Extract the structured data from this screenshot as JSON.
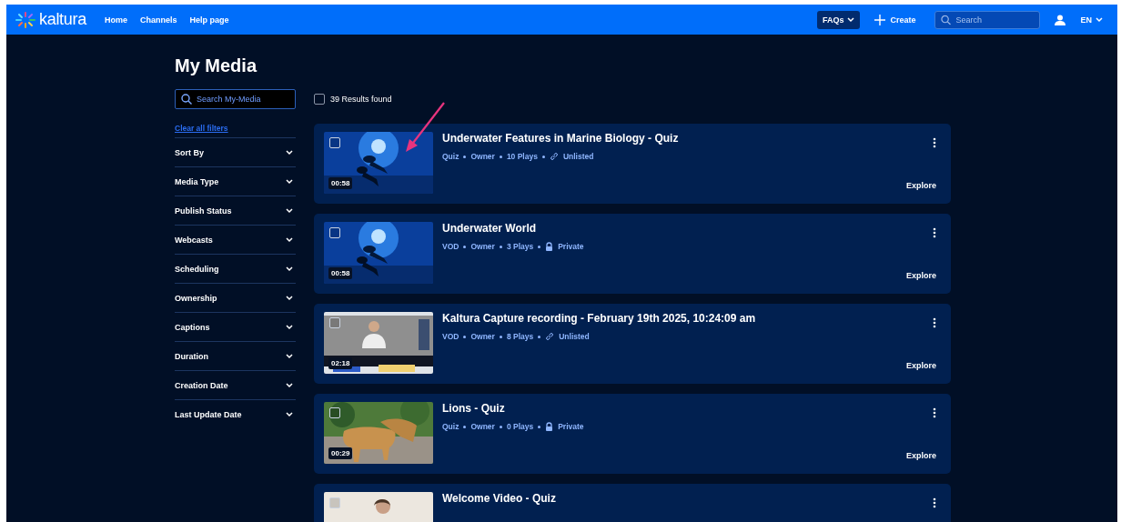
{
  "header": {
    "logo": "kaltura",
    "nav": [
      "Home",
      "Channels",
      "Help page"
    ],
    "faqs": "FAQs",
    "create": "Create",
    "search": {
      "placeholder": "Search"
    },
    "language": "EN"
  },
  "page_title": "My Media",
  "search": {
    "placeholder": "Search My-Media"
  },
  "results": {
    "label": "39 Results found",
    "checked": false
  },
  "clear_filters": "Clear all filters",
  "filters": [
    {
      "label": "Sort By",
      "expanded": false
    },
    {
      "label": "Media Type",
      "expanded": false
    },
    {
      "label": "Publish Status",
      "expanded": false
    },
    {
      "label": "Webcasts",
      "expanded": false
    },
    {
      "label": "Scheduling",
      "expanded": false
    },
    {
      "label": "Ownership",
      "expanded": false
    },
    {
      "label": "Captions",
      "expanded": false
    },
    {
      "label": "Duration",
      "expanded": false
    },
    {
      "label": "Creation Date",
      "expanded": false
    },
    {
      "label": "Last Update Date",
      "expanded": false
    }
  ],
  "media": [
    {
      "title": "Underwater Features in Marine Biology - Quiz",
      "duration": "00:58",
      "checked": false,
      "meta": [
        "Quiz",
        "Owner",
        "10 Plays"
      ],
      "privacy": {
        "kind": "link",
        "label": "Unlisted"
      },
      "action": "Explore"
    },
    {
      "title": "Underwater World",
      "duration": "00:58",
      "checked": false,
      "meta": [
        "VOD",
        "Owner",
        "3 Plays"
      ],
      "privacy": {
        "kind": "lock",
        "label": "Private"
      },
      "action": "Explore"
    },
    {
      "title": "Kaltura Capture recording - February 19th 2025, 10:24:09 am",
      "duration": "02:18",
      "checked": false,
      "meta": [
        "VOD",
        "Owner",
        "8 Plays"
      ],
      "privacy": {
        "kind": "link",
        "label": "Unlisted"
      },
      "action": "Explore"
    },
    {
      "title": "Lions - Quiz",
      "duration": "00:29",
      "checked": false,
      "meta": [
        "Quiz",
        "Owner",
        "0 Plays"
      ],
      "privacy": {
        "kind": "lock",
        "label": "Private"
      },
      "action": "Explore"
    },
    {
      "title": "Welcome Video - Quiz",
      "checked": false
    }
  ]
}
